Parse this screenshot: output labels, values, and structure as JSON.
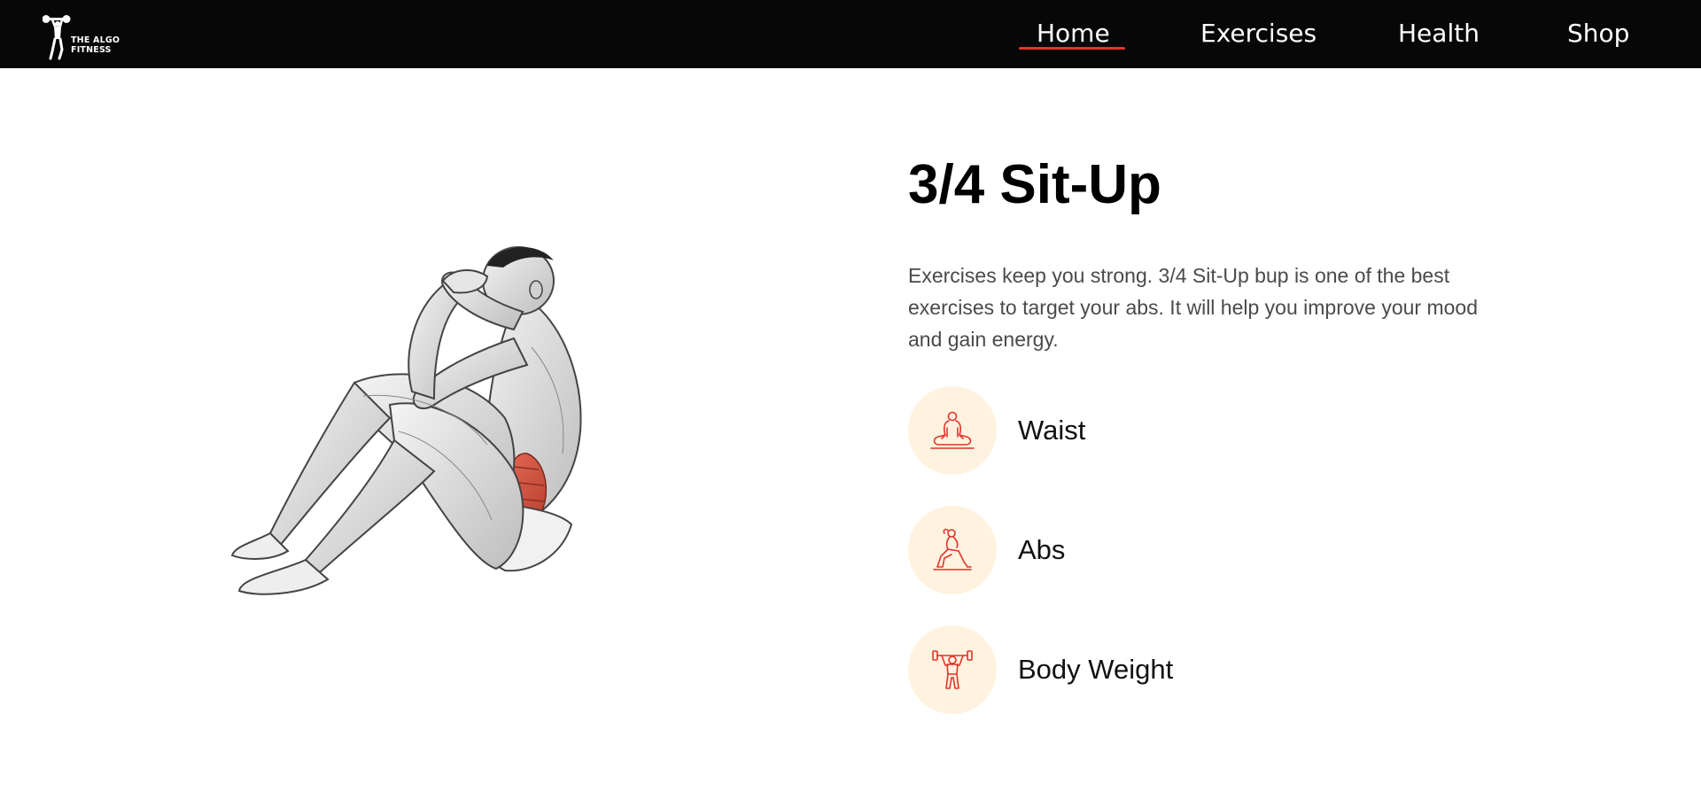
{
  "brand": {
    "logo_line1": "THE ALGO",
    "logo_line2": "FITNESS"
  },
  "nav": {
    "items": [
      {
        "label": "Home",
        "active": true
      },
      {
        "label": "Exercises"
      },
      {
        "label": "Health"
      },
      {
        "label": "Shop"
      }
    ],
    "active_color": "#e4332b"
  },
  "exercise": {
    "title": "3/4 Sit-Up",
    "description": "Exercises keep you strong. 3/4 Sit-Up bup is one of the best exercises to target your abs. It will help you improve your mood and gain energy.",
    "tags": [
      {
        "label": "Waist",
        "icon": "meditation-icon"
      },
      {
        "label": "Abs",
        "icon": "lunge-icon"
      },
      {
        "label": "Body Weight",
        "icon": "weightlifter-icon"
      }
    ]
  },
  "colors": {
    "navbar_bg": "#070707",
    "tag_circle_bg": "#fff2df",
    "icon_stroke": "#e4332b"
  }
}
